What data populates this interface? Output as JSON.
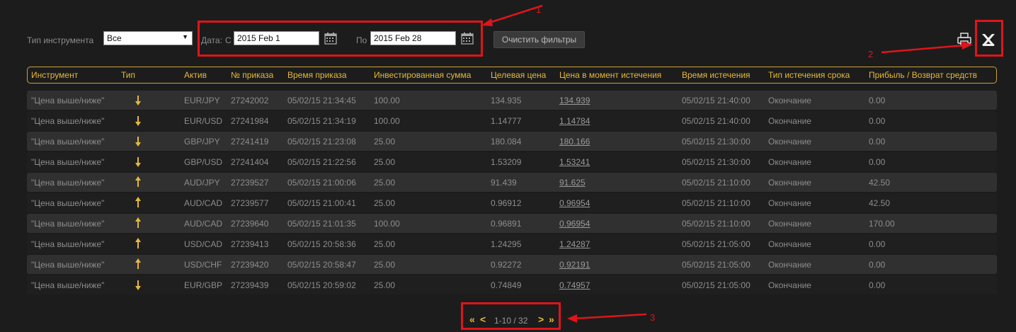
{
  "filters": {
    "instrument_type_label": "Тип инструмента",
    "instrument_type_value": "Все",
    "date_label": "Дата:",
    "from_label": "С",
    "from_value": "2015 Feb 1",
    "to_label": "По",
    "to_value": "2015 Feb 28",
    "clear_label": "Очистить фильтры"
  },
  "annotations": {
    "a1": "1",
    "a2": "2",
    "a3": "3"
  },
  "colors": {
    "accent": "#e6b93a",
    "annotation": "#e0141b"
  },
  "icons": {
    "print": "printer-icon",
    "excel": "excel-export-icon",
    "calendar": "calendar-icon"
  },
  "table": {
    "headers": [
      "Инструмент",
      "Тип",
      "Актив",
      "№ приказа",
      "Время приказа",
      "Инвестированная сумма",
      "Целевая цена",
      "Цена в момент истечения",
      "Время истечения",
      "Тип истечения срока",
      "Прибыль / Возврат средств"
    ],
    "rows": [
      {
        "instrument": "\"Цена выше/ниже\"",
        "dir": "down",
        "asset": "EUR/JPY",
        "order": "27242002",
        "order_time": "05/02/15 21:34:45",
        "amount": "100.00",
        "target": "134.935",
        "expiry_price": "134.939",
        "expiry_time": "05/02/15 21:40:00",
        "expiry_type": "Окончание",
        "profit": "0.00"
      },
      {
        "instrument": "\"Цена выше/ниже\"",
        "dir": "down",
        "asset": "EUR/USD",
        "order": "27241984",
        "order_time": "05/02/15 21:34:19",
        "amount": "100.00",
        "target": "1.14777",
        "expiry_price": "1.14784",
        "expiry_time": "05/02/15 21:40:00",
        "expiry_type": "Окончание",
        "profit": "0.00"
      },
      {
        "instrument": "\"Цена выше/ниже\"",
        "dir": "down",
        "asset": "GBP/JPY",
        "order": "27241419",
        "order_time": "05/02/15 21:23:08",
        "amount": "25.00",
        "target": "180.084",
        "expiry_price": "180.166",
        "expiry_time": "05/02/15 21:30:00",
        "expiry_type": "Окончание",
        "profit": "0.00"
      },
      {
        "instrument": "\"Цена выше/ниже\"",
        "dir": "down",
        "asset": "GBP/USD",
        "order": "27241404",
        "order_time": "05/02/15 21:22:56",
        "amount": "25.00",
        "target": "1.53209",
        "expiry_price": "1.53241",
        "expiry_time": "05/02/15 21:30:00",
        "expiry_type": "Окончание",
        "profit": "0.00"
      },
      {
        "instrument": "\"Цена выше/ниже\"",
        "dir": "up",
        "asset": "AUD/JPY",
        "order": "27239527",
        "order_time": "05/02/15 21:00:06",
        "amount": "25.00",
        "target": "91.439",
        "expiry_price": "91.625",
        "expiry_time": "05/02/15 21:10:00",
        "expiry_type": "Окончание",
        "profit": "42.50"
      },
      {
        "instrument": "\"Цена выше/ниже\"",
        "dir": "up",
        "asset": "AUD/CAD",
        "order": "27239577",
        "order_time": "05/02/15 21:00:41",
        "amount": "25.00",
        "target": "0.96912",
        "expiry_price": "0.96954",
        "expiry_time": "05/02/15 21:10:00",
        "expiry_type": "Окончание",
        "profit": "42.50"
      },
      {
        "instrument": "\"Цена выше/ниже\"",
        "dir": "up",
        "asset": "AUD/CAD",
        "order": "27239640",
        "order_time": "05/02/15 21:01:35",
        "amount": "100.00",
        "target": "0.96891",
        "expiry_price": "0.96954",
        "expiry_time": "05/02/15 21:10:00",
        "expiry_type": "Окончание",
        "profit": "170.00"
      },
      {
        "instrument": "\"Цена выше/ниже\"",
        "dir": "up",
        "asset": "USD/CAD",
        "order": "27239413",
        "order_time": "05/02/15 20:58:36",
        "amount": "25.00",
        "target": "1.24295",
        "expiry_price": "1.24287",
        "expiry_time": "05/02/15 21:05:00",
        "expiry_type": "Окончание",
        "profit": "0.00"
      },
      {
        "instrument": "\"Цена выше/ниже\"",
        "dir": "up",
        "asset": "USD/CHF",
        "order": "27239420",
        "order_time": "05/02/15 20:58:47",
        "amount": "25.00",
        "target": "0.92272",
        "expiry_price": "0.92191",
        "expiry_time": "05/02/15 21:05:00",
        "expiry_type": "Окончание",
        "profit": "0.00"
      },
      {
        "instrument": "\"Цена выше/ниже\"",
        "dir": "down",
        "asset": "EUR/GBP",
        "order": "27239439",
        "order_time": "05/02/15 20:59:02",
        "amount": "25.00",
        "target": "0.74849",
        "expiry_price": "0.74957",
        "expiry_time": "05/02/15 21:05:00",
        "expiry_type": "Окончание",
        "profit": "0.00"
      }
    ]
  },
  "pagination": {
    "first": "«",
    "prev": "<",
    "range": "1-10 / 32",
    "next": ">",
    "last": "»"
  }
}
